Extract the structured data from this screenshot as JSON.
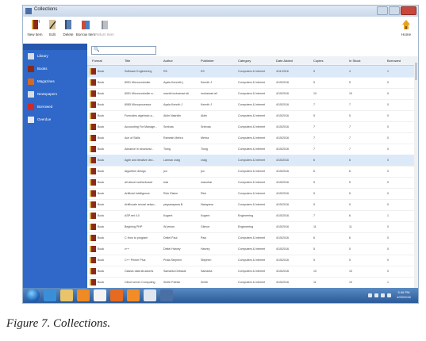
{
  "window": {
    "title": "Collections"
  },
  "toolbar": {
    "items": [
      {
        "label": "New Item",
        "icon": "new-item-icon"
      },
      {
        "label": "Edit",
        "icon": "edit-icon"
      },
      {
        "label": "Delete",
        "icon": "delete-icon"
      },
      {
        "label": "Borrow Item",
        "icon": "borrow-item-icon"
      },
      {
        "label": "Return Item",
        "icon": "return-item-icon"
      }
    ],
    "home_label": "Home"
  },
  "sidebar": {
    "items": [
      {
        "label": "Library",
        "icon": "library-icon",
        "color": "#d7dce6"
      },
      {
        "label": "Books",
        "icon": "books-icon",
        "color": "#8b2a1a"
      },
      {
        "label": "Magazines",
        "icon": "magazines-icon",
        "color": "#d06a2a"
      },
      {
        "label": "Newspapers",
        "icon": "newspapers-icon",
        "color": "#d8dde3"
      },
      {
        "label": "Borrowed",
        "icon": "borrowed-icon",
        "color": "#cf2a2a"
      },
      {
        "label": "Overdue",
        "icon": "overdue-icon",
        "color": "#e8ecf2"
      }
    ]
  },
  "search": {
    "icon": "search-icon",
    "value": ""
  },
  "table": {
    "columns": [
      "Format",
      "Title",
      "Author",
      "Publisher",
      "Category",
      "Date Added",
      "Copies",
      "In Stock",
      "Borrowed"
    ],
    "rows": [
      [
        "Book",
        "Software Engineering",
        "RK",
        "KS",
        "Computers & Internet",
        "4/11/2016",
        "5",
        "4",
        "1"
      ],
      [
        "Book",
        "8051 Microcontroller",
        "Ayala Kenneth j",
        "Kennth J",
        "Computers & Internet",
        "4/15/2016",
        "5",
        "5",
        "0"
      ],
      [
        "Book",
        "8051 Microcontroller a...",
        "mazidi muhamad ali",
        "muhamad ali",
        "Computers & Internet",
        "4/15/2016",
        "10",
        "10",
        "0"
      ],
      [
        "Book",
        "8085 Microprocessor",
        "Ayala Kennth J",
        "Kennth J",
        "Computers & Internet",
        "4/15/2016",
        "7",
        "7",
        "0"
      ],
      [
        "Book",
        "Fumrzdes algebraic a...",
        "Aldin Nasridin",
        "Aldin",
        "Computers & Internet",
        "4/15/2016",
        "5",
        "5",
        "0"
      ],
      [
        "Book",
        "Accounting For Manage...",
        "Srinivas",
        "Srinivas",
        "Computers & Internet",
        "4/15/2016",
        "7",
        "7",
        "0"
      ],
      [
        "Book",
        "Ace of Skills",
        "Ramesh Mehra",
        "Mehra",
        "Computers & Internet",
        "4/15/2016",
        "7",
        "7",
        "0"
      ],
      [
        "Book",
        "Advance in structural...",
        "Tiong",
        "Tiong",
        "Computers & Internet",
        "4/15/2016",
        "7",
        "7",
        "0"
      ],
      [
        "Book",
        "Agile and iterative dev...",
        "Larman craig",
        "craig",
        "Computers & Internet",
        "4/15/2016",
        "6",
        "6",
        "0"
      ],
      [
        "Book",
        "Algorithm design",
        "jon",
        "jon",
        "Computers & Internet",
        "4/15/2016",
        "6",
        "6",
        "0"
      ],
      [
        "Book",
        "all about motherboard",
        "tota",
        "manohar",
        "Computers & Internet",
        "4/15/2016",
        "5",
        "5",
        "0"
      ],
      [
        "Book",
        "Artificial Intelligence",
        "Rich Elaine",
        "Rich",
        "Computers & Internet",
        "4/15/2016",
        "5",
        "5",
        "0"
      ],
      [
        "Book",
        "Artificuale neural netwo...",
        "yegnarayana B",
        "Narayana",
        "Computers & Internet",
        "4/15/2016",
        "9",
        "9",
        "0"
      ],
      [
        "Book",
        "ASP.net 4.0",
        "Kogent",
        "Kogent",
        "Engineering",
        "4/15/2016",
        "7",
        "6",
        "1"
      ],
      [
        "Book",
        "Begining PHP",
        "W jerson",
        "Gilmon",
        "Engineering",
        "4/15/2016",
        "11",
        "11",
        "0"
      ],
      [
        "Book",
        "C How to program",
        "Deitel Paul",
        "Paul",
        "Computers & Internet",
        "4/15/2016",
        "6",
        "6",
        "0"
      ],
      [
        "Book",
        "c++",
        "Deitel Harvey",
        "Harvey",
        "Computers & Internet",
        "4/15/2016",
        "5",
        "5",
        "0"
      ],
      [
        "Book",
        "C++ Primer Plus",
        "Prata Stephen",
        "Stephen",
        "Computers & Internet",
        "4/15/2016",
        "5",
        "5",
        "0"
      ],
      [
        "Book",
        "Classic data structures",
        "Samanta Debasis",
        "Samanta",
        "Computers & Internet",
        "4/15/2016",
        "10",
        "10",
        "0"
      ],
      [
        "Book",
        "Client server Computing",
        "Smith Patrick",
        "Smith",
        "Computers & Internet",
        "4/15/2016",
        "11",
        "10",
        "1"
      ]
    ],
    "selected_rows": [
      0,
      8
    ]
  },
  "taskbar": {
    "apps": [
      {
        "icon": "ie-icon",
        "color": "#3b8fd9"
      },
      {
        "icon": "folder-icon",
        "color": "#e9c46a"
      },
      {
        "icon": "media-player-icon",
        "color": "#f08a24"
      },
      {
        "icon": "chrome-icon",
        "color": "#f3f3f3"
      },
      {
        "icon": "firefox-icon",
        "color": "#e66a1f"
      },
      {
        "icon": "app-icon",
        "color": "#f28c28"
      },
      {
        "icon": "document-icon",
        "color": "#dfe6ef"
      },
      {
        "icon": "app-window-icon",
        "color": "#4a6fa5"
      }
    ],
    "clock_time": "5:46 PM",
    "clock_date": "4/25/2016"
  },
  "caption": {
    "figure": "Figure 7",
    "text": ". Collections."
  }
}
